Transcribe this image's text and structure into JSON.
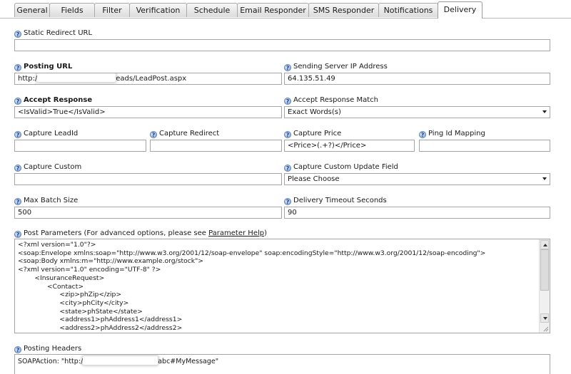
{
  "tabs": [
    {
      "label": "General"
    },
    {
      "label": "Fields"
    },
    {
      "label": "Filter"
    },
    {
      "label": "Verification"
    },
    {
      "label": "Schedule"
    },
    {
      "label": "Email Responder"
    },
    {
      "label": "SMS Responder"
    },
    {
      "label": "Notifications"
    },
    {
      "label": "Delivery",
      "active": true
    }
  ],
  "help_glyph": "?",
  "static_redirect": {
    "label": "Static Redirect URL",
    "value": ""
  },
  "posting_url": {
    "label": "Posting URL",
    "value_start": "http:/",
    "value_end": "eads/LeadPost.aspx"
  },
  "sending_ip": {
    "label": "Sending Server IP Address",
    "value": "64.135.51.49"
  },
  "accept_response": {
    "label": "Accept Response",
    "value": "<IsValid>True</IsValid>"
  },
  "accept_match": {
    "label": "Accept Response Match",
    "value": "Exact Words(s)"
  },
  "capture_leadid": {
    "label": "Capture LeadId",
    "value": ""
  },
  "capture_redirect": {
    "label": "Capture Redirect",
    "value": ""
  },
  "capture_price": {
    "label": "Capture Price",
    "value": "<Price>(.+?)</Price>"
  },
  "ping_id": {
    "label": "Ping Id Mapping",
    "value": ""
  },
  "capture_custom": {
    "label": "Capture Custom",
    "value": ""
  },
  "capture_custom_update": {
    "label": "Capture Custom Update Field",
    "value": "Please Choose"
  },
  "max_batch": {
    "label": "Max Batch Size",
    "value": "500"
  },
  "delivery_timeout": {
    "label": "Delivery Timeout Seconds",
    "value": "90"
  },
  "post_params": {
    "label_prefix": "Post Parameters (For advanced options, please see ",
    "link": "Parameter Help",
    "label_suffix": ")",
    "value": "<?xml version=\"1.0\"?>\n<soap:Envelope xmlns:soap=\"http://www.w3.org/2001/12/soap-envelope\" soap:encodingStyle=\"http://www.w3.org/2001/12/soap-encoding\">\n<soap:Body xmlns:m=\"http://www.example.org/stock\">\n<?xml version=\"1.0\" encoding=\"UTF-8\" ?>\n        <InsuranceRequest>\n              <Contact>\n                    <zip>phZip</zip>\n                    <city>phCity</city>\n                    <state>phState</state>\n                    <address1>phAddress1</address1>\n                    <address2>phAddress2</address2>"
  },
  "posting_headers": {
    "label": "Posting Headers",
    "value_start": "SOAPAction: \"http:/",
    "value_end": "abc#MyMessage\""
  }
}
